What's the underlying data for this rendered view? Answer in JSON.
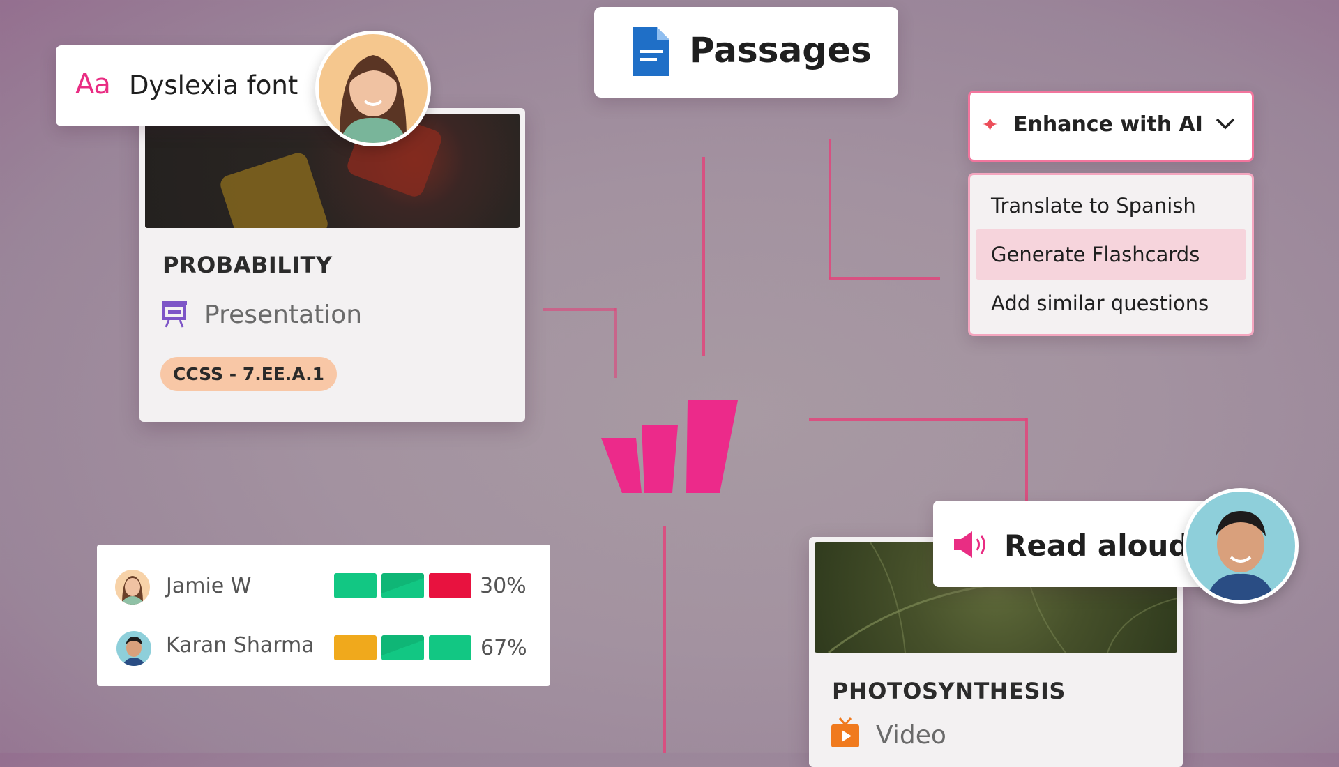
{
  "dyslexia": {
    "icon_text": "Aa",
    "label": "Dyslexia font"
  },
  "passages": {
    "label": "Passages"
  },
  "probability_card": {
    "title": "PROBABILITY",
    "type_label": "Presentation",
    "standard_tag": "CCSS - 7.EE.A.1"
  },
  "enhance": {
    "label": "Enhance with AI",
    "menu_items": [
      "Translate to Spanish",
      "Generate Flashcards",
      "Add similar questions"
    ],
    "selected_index": 1
  },
  "students": [
    {
      "name": "Jamie W",
      "percent": "30%",
      "bars": [
        "#12c783",
        "#12c783",
        "#e8123f"
      ]
    },
    {
      "name": "Karan Sharma",
      "percent": "67%",
      "bars": [
        "#f0a91c",
        "#12c783",
        "#12c783"
      ]
    }
  ],
  "read_aloud": {
    "label": "Read aloud"
  },
  "photosynthesis_card": {
    "title": "PHOTOSYNTHESIS",
    "type_label": "Video"
  },
  "colors": {
    "accent_pink": "#e92d83",
    "line_pink": "#e0457b"
  }
}
